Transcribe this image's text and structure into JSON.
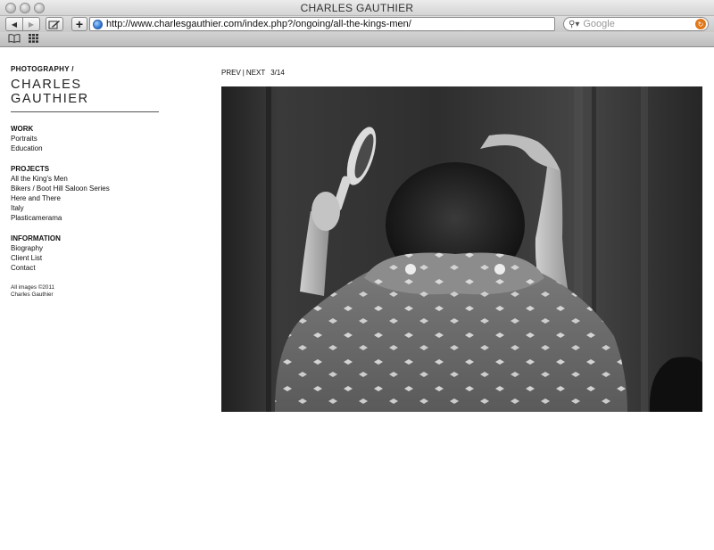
{
  "window": {
    "title": "CHARLES GAUTHIER"
  },
  "toolbar": {
    "url": "http://www.charlesgauthier.com/index.php?/ongoing/all-the-kings-men/",
    "search_placeholder": "Google"
  },
  "site": {
    "kicker": "PHOTOGRAPHY /",
    "name": "CHARLES GAUTHIER"
  },
  "menu": {
    "work": {
      "heading": "WORK",
      "items": [
        "Portraits",
        "Education"
      ]
    },
    "projects": {
      "heading": "PROJECTS",
      "items": [
        "All the King's Men",
        "Bikers / Boot Hill Saloon Series",
        "Here and There",
        "Italy",
        "Plasticamerama"
      ]
    },
    "information": {
      "heading": "INFORMATION",
      "items": [
        "Biography",
        "Client List",
        "Contact"
      ]
    },
    "copyright_line1": "All images ©2011",
    "copyright_line2": "Charles Gauthier"
  },
  "photo_nav": {
    "prev": "PREV",
    "separator": "|",
    "next": "NEXT",
    "counter": "3/14"
  },
  "colors": {
    "accent_search_go": "#e27618",
    "rule": "#555555"
  }
}
